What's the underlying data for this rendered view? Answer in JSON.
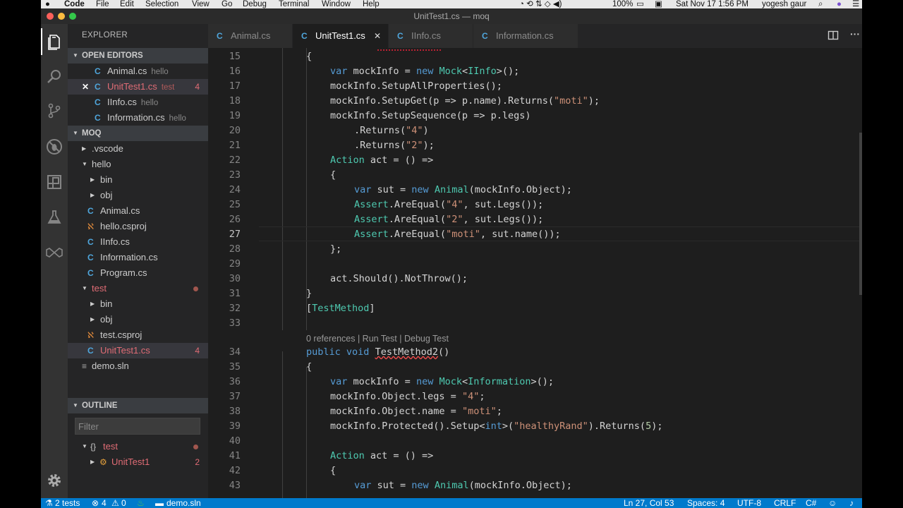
{
  "menubar": {
    "app": "Code",
    "items": [
      "File",
      "Edit",
      "Selection",
      "View",
      "Go",
      "Debug",
      "Terminal",
      "Window",
      "Help"
    ],
    "battery": "100%",
    "datetime": "Sat Nov 17  1:56 PM",
    "user": "yogesh gaur"
  },
  "window": {
    "title": "UnitTest1.cs — moq"
  },
  "sidebar": {
    "title": "EXPLORER",
    "open_editors": {
      "header": "OPEN EDITORS",
      "items": [
        {
          "name": "Animal.cs",
          "desc": "hello"
        },
        {
          "name": "UnitTest1.cs",
          "desc": "test",
          "count": "4"
        },
        {
          "name": "IInfo.cs",
          "desc": "hello"
        },
        {
          "name": "Information.cs",
          "desc": "hello"
        }
      ]
    },
    "folder": {
      "header": "MOQ",
      "items": [
        {
          "name": ".vscode"
        },
        {
          "name": "hello"
        },
        {
          "name": "bin"
        },
        {
          "name": "obj"
        },
        {
          "name": "Animal.cs"
        },
        {
          "name": "hello.csproj"
        },
        {
          "name": "IInfo.cs"
        },
        {
          "name": "Information.cs"
        },
        {
          "name": "Program.cs"
        },
        {
          "name": "test"
        },
        {
          "name": "bin"
        },
        {
          "name": "obj"
        },
        {
          "name": "test.csproj"
        },
        {
          "name": "UnitTest1.cs",
          "count": "4"
        },
        {
          "name": "demo.sln"
        }
      ]
    },
    "outline": {
      "header": "OUTLINE",
      "filter_placeholder": "Filter",
      "items": [
        {
          "name": "test"
        },
        {
          "name": "UnitTest1",
          "count": "2"
        }
      ]
    }
  },
  "tabs": [
    {
      "label": "Animal.cs"
    },
    {
      "label": "UnitTest1.cs"
    },
    {
      "label": "IInfo.cs"
    },
    {
      "label": "Information.cs"
    }
  ],
  "editor": {
    "codelens": "0 references | Run Test | Debug Test",
    "lines": [
      {
        "n": "15",
        "text": "{"
      },
      {
        "n": "16",
        "text": "var mockInfo = new Mock<IInfo>();"
      },
      {
        "n": "17",
        "text": "mockInfo.SetupAllProperties();"
      },
      {
        "n": "18",
        "text": "mockInfo.SetupGet(p => p.name).Returns(\"moti\");"
      },
      {
        "n": "19",
        "text": "mockInfo.SetupSequence(p => p.legs)"
      },
      {
        "n": "20",
        "text": ".Returns(\"4\")"
      },
      {
        "n": "21",
        "text": ".Returns(\"2\");"
      },
      {
        "n": "22",
        "text": "Action act = () =>"
      },
      {
        "n": "23",
        "text": "{"
      },
      {
        "n": "24",
        "text": "var sut = new Animal(mockInfo.Object);"
      },
      {
        "n": "25",
        "text": "Assert.AreEqual(\"4\", sut.Legs());"
      },
      {
        "n": "26",
        "text": "Assert.AreEqual(\"2\", sut.Legs());"
      },
      {
        "n": "27",
        "text": "Assert.AreEqual(\"moti\", sut.name());"
      },
      {
        "n": "28",
        "text": "};"
      },
      {
        "n": "29",
        "text": ""
      },
      {
        "n": "30",
        "text": "act.Should().NotThrow();"
      },
      {
        "n": "31",
        "text": "}"
      },
      {
        "n": "32",
        "text": "[TestMethod]"
      },
      {
        "n": "33",
        "text": ""
      },
      {
        "n": "34",
        "text": "public void TestMethod2()"
      },
      {
        "n": "35",
        "text": "{"
      },
      {
        "n": "36",
        "text": "var mockInfo = new Mock<Information>();"
      },
      {
        "n": "37",
        "text": "mockInfo.Object.legs = \"4\";"
      },
      {
        "n": "38",
        "text": "mockInfo.Object.name = \"moti\";"
      },
      {
        "n": "39",
        "text": "mockInfo.Protected().Setup<int>(\"healthyRand\").Returns(5);"
      },
      {
        "n": "40",
        "text": ""
      },
      {
        "n": "41",
        "text": "Action act = () =>"
      },
      {
        "n": "42",
        "text": "{"
      },
      {
        "n": "43",
        "text": "var sut = new Animal(mockInfo.Object);"
      }
    ]
  },
  "statusbar": {
    "tests": "2 tests",
    "errors": "4",
    "warnings": "0",
    "solution": "demo.sln",
    "position": "Ln 27, Col 53",
    "spaces": "Spaces: 4",
    "encoding": "UTF-8",
    "eol": "CRLF",
    "language": "C#"
  },
  "colors": {
    "status_bar": "#007acc",
    "keyword": "#569cd6",
    "type": "#4ec9b0",
    "string": "#ce9178",
    "error": "#e06c75"
  }
}
